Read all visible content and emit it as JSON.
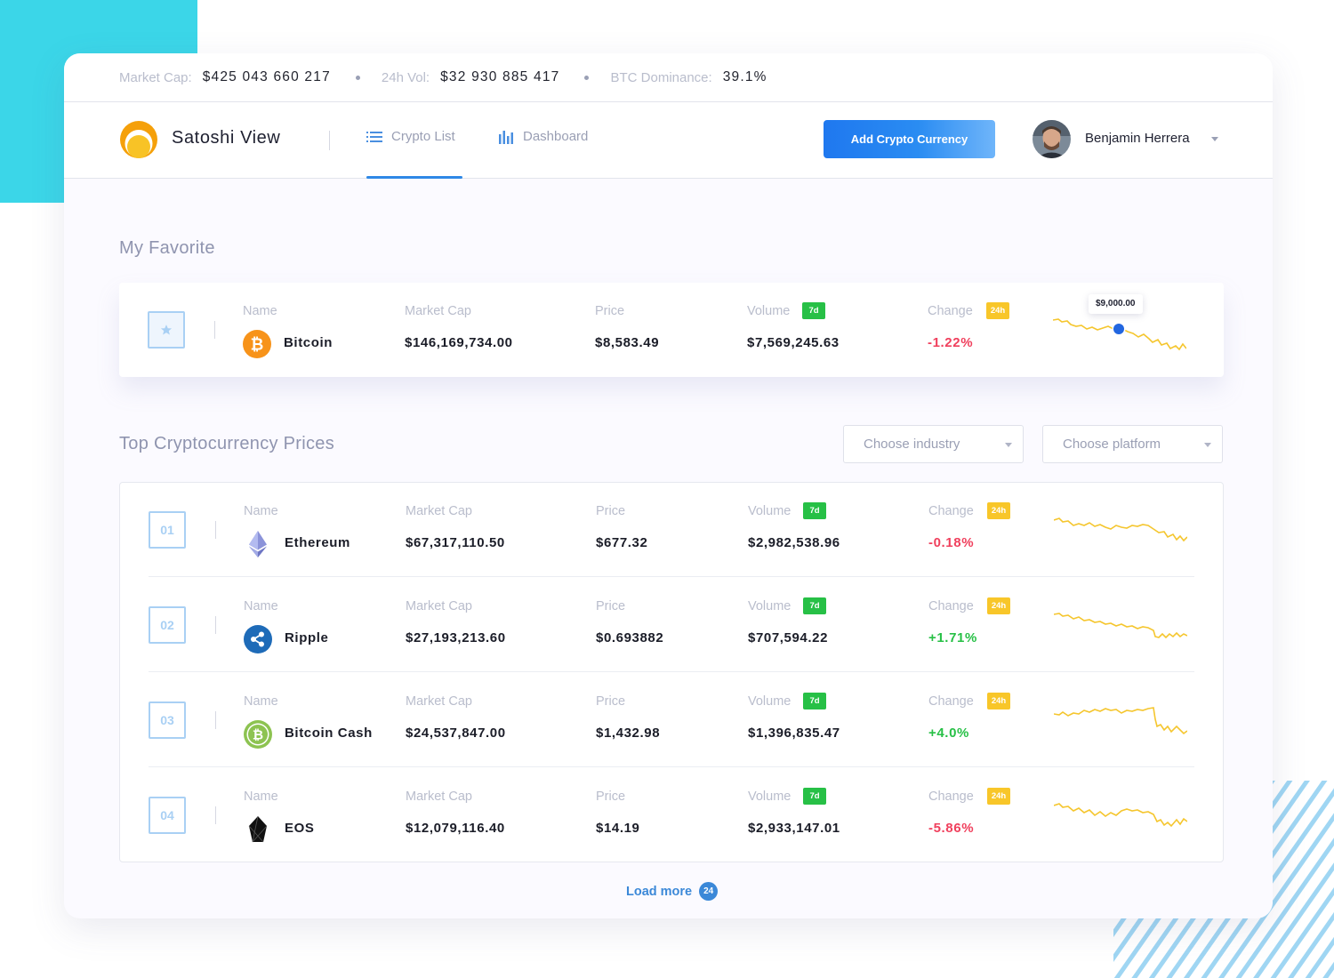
{
  "topbar": {
    "market_cap_label": "Market Cap:",
    "market_cap_value": "$425 043 660 217",
    "volume_label": "24h Vol:",
    "volume_value": "$32 930 885 417",
    "dominance_label": "BTC Dominance:",
    "dominance_value": "39.1%"
  },
  "nav": {
    "brand": "Satoshi View",
    "crypto_list": "Crypto List",
    "dashboard": "Dashboard",
    "add_button": "Add Crypto Currency",
    "user_name": "Benjamin Herrera"
  },
  "labels": {
    "name": "Name",
    "market_cap": "Market Cap",
    "price": "Price",
    "volume": "Volume",
    "change": "Change",
    "badge_7d": "7d",
    "badge_24h": "24h"
  },
  "favorite": {
    "title": "My Favorite",
    "tooltip": "$9,000.00",
    "coin": {
      "name": "Bitcoin",
      "icon": "bitcoin-icon",
      "market_cap": "$146,169,734.00",
      "price": "$8,583.49",
      "volume": "$7,569,245.63",
      "change": "-1.22%",
      "trend": "down"
    }
  },
  "top": {
    "title": "Top Cryptocurrency Prices",
    "industry_placeholder": "Choose industry",
    "platform_placeholder": "Choose platform",
    "coins": [
      {
        "rank": "01",
        "name": "Ethereum",
        "icon": "ethereum-icon",
        "market_cap": "$67,317,110.50",
        "price": "$677.32",
        "volume": "$2,982,538.96",
        "change": "-0.18%",
        "trend": "down"
      },
      {
        "rank": "02",
        "name": "Ripple",
        "icon": "ripple-icon",
        "market_cap": "$27,193,213.60",
        "price": "$0.693882",
        "volume": "$707,594.22",
        "change": "+1.71%",
        "trend": "up"
      },
      {
        "rank": "03",
        "name": "Bitcoin Cash",
        "icon": "bitcoin-cash-icon",
        "market_cap": "$24,537,847.00",
        "price": "$1,432.98",
        "volume": "$1,396,835.47",
        "change": "+4.0%",
        "trend": "up"
      },
      {
        "rank": "04",
        "name": "EOS",
        "icon": "eos-icon",
        "market_cap": "$12,079,116.40",
        "price": "$14.19",
        "volume": "$2,933,147.01",
        "change": "-5.86%",
        "trend": "down"
      }
    ]
  },
  "load_more": {
    "label": "Load more",
    "count": "24"
  },
  "colors": {
    "accent": "#2f88e6",
    "positive": "#27c046",
    "negative": "#f0405d",
    "sparkline": "#f5c62e",
    "badge_7d": "#27c046",
    "badge_24h": "#f8c629"
  }
}
